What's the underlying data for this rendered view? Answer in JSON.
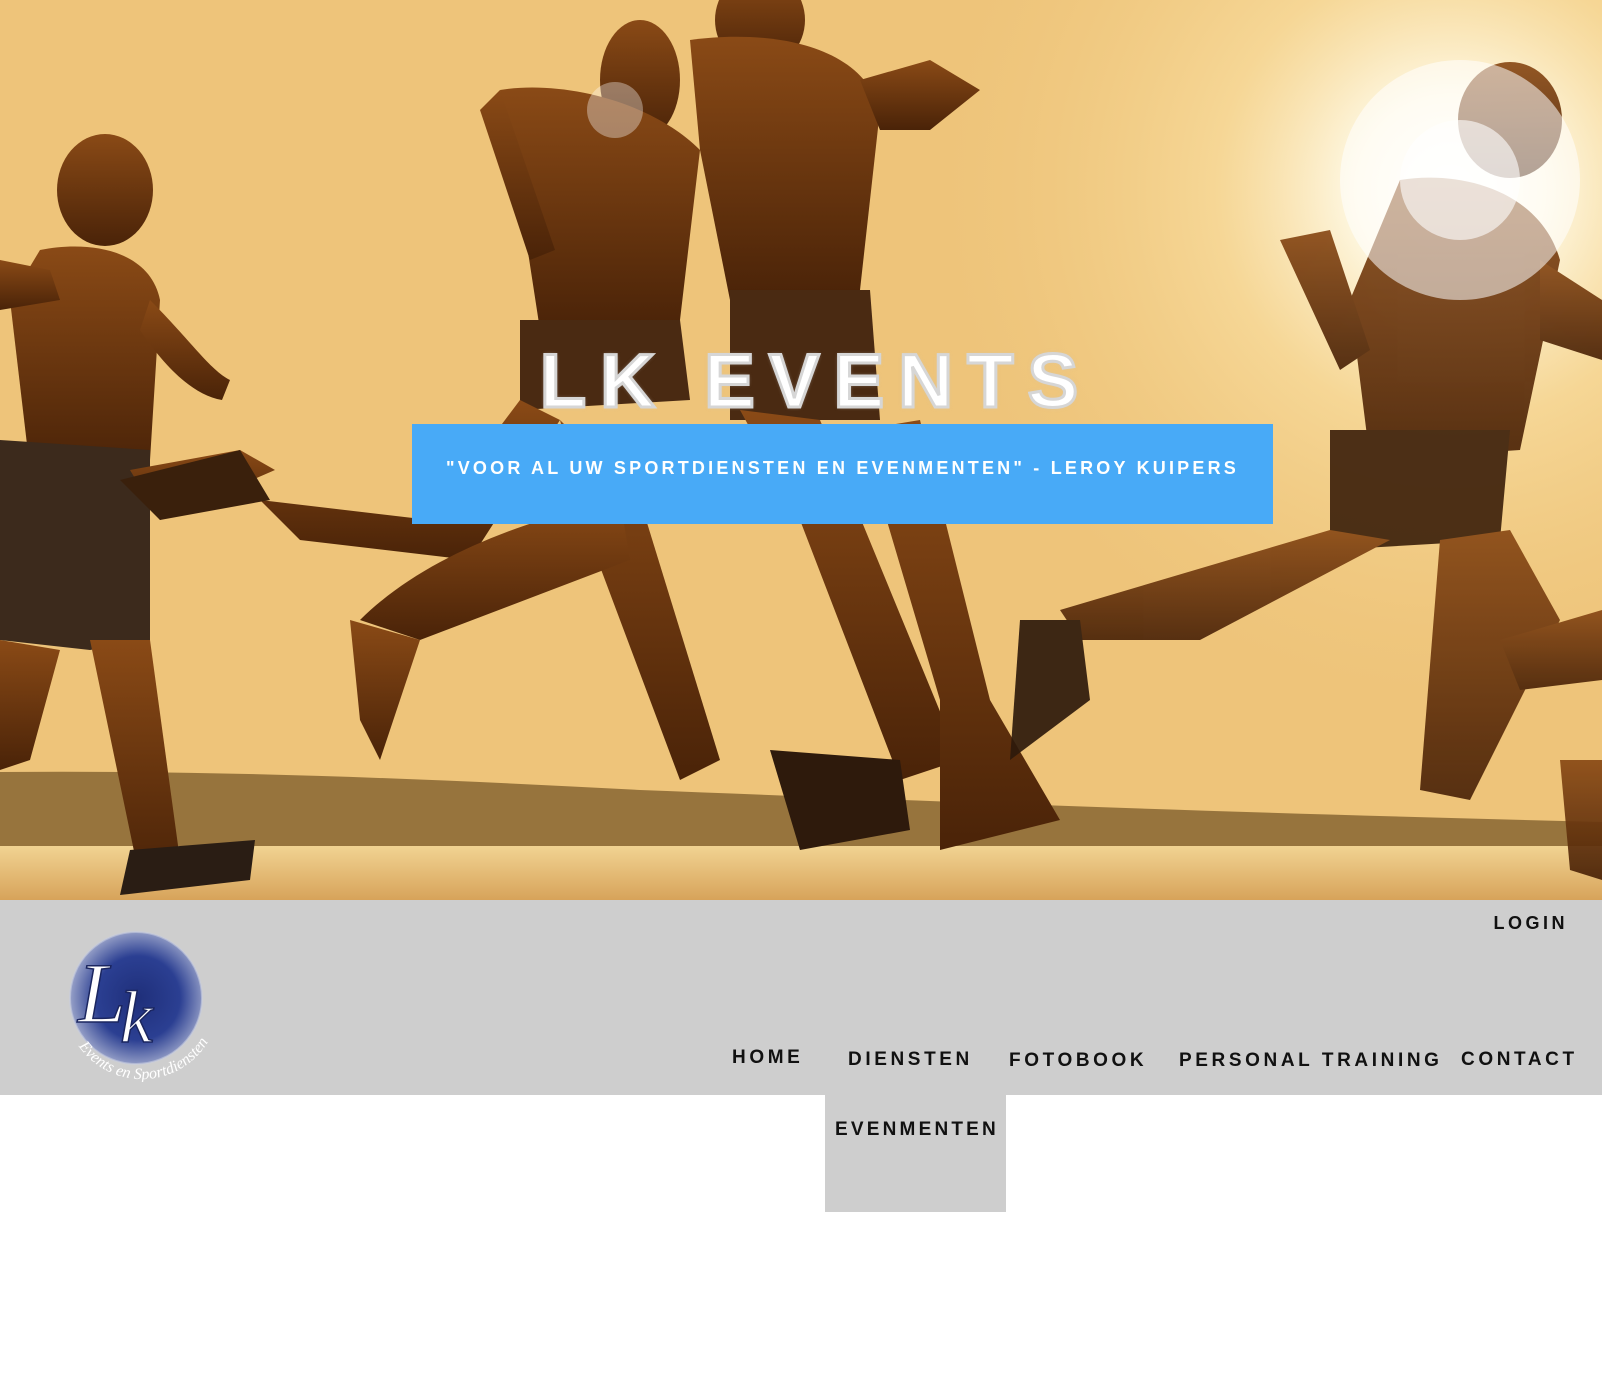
{
  "hero": {
    "title": "LK EVENTS",
    "tagline": "\"VOOR AL UW SPORTDIENSTEN EN EVENMENTEN\" - LEROY KUIPERS",
    "background_image": "runners-at-sunset-photo",
    "tagline_box_color": "#48aaf7"
  },
  "header": {
    "logo": {
      "monogram": "LK",
      "ring_text": "Events en Sportdiensten",
      "icon": "lk-logo"
    },
    "login_label": "LOGIN",
    "background_color": "#cecece"
  },
  "nav": {
    "items": [
      {
        "label": "HOME"
      },
      {
        "label": "DIENSTEN"
      },
      {
        "label": "FOTOBOOK"
      },
      {
        "label": "PERSONAL TRAINING"
      },
      {
        "label": "CONTACT"
      }
    ],
    "diensten_dropdown": [
      {
        "label": "EVENMENTEN"
      }
    ]
  }
}
